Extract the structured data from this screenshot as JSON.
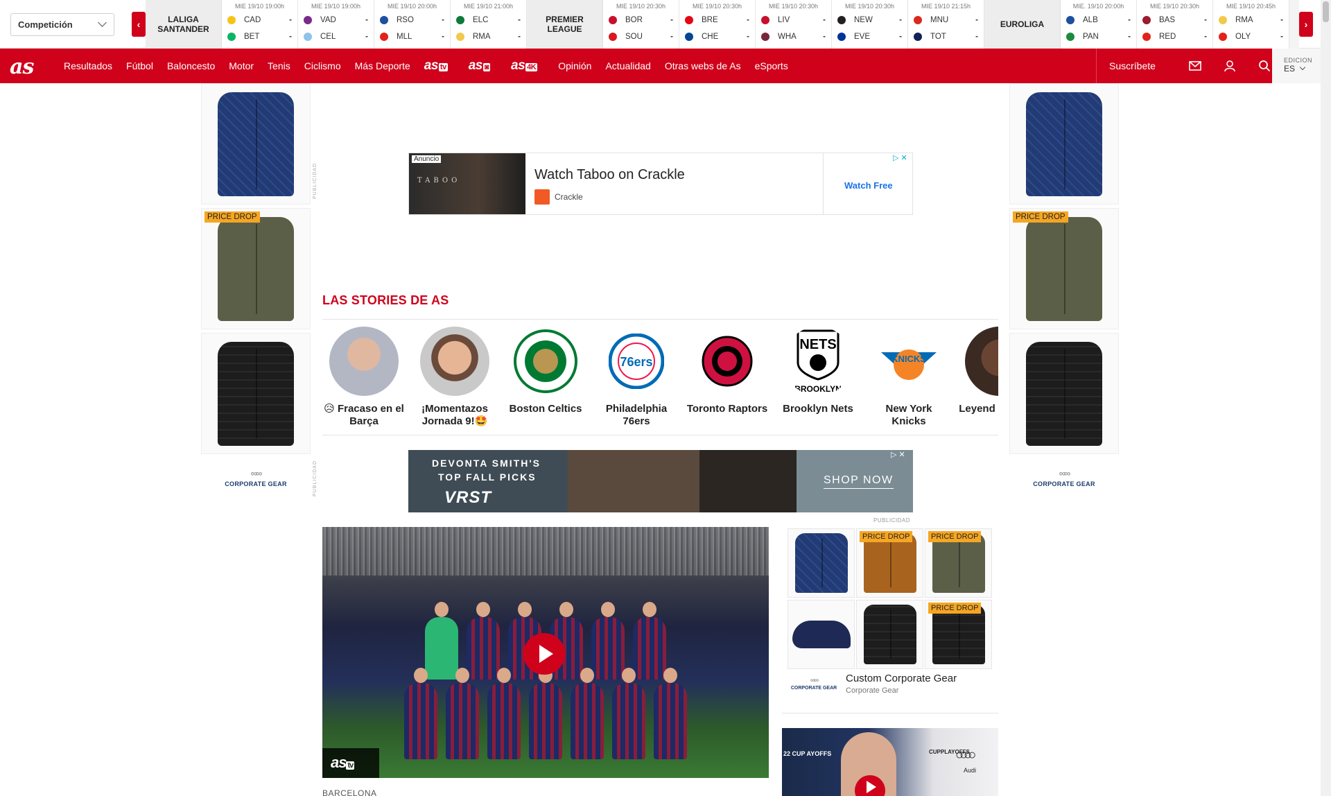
{
  "competition_select": {
    "label": "Competición"
  },
  "leagues": [
    {
      "name_l1": "LALIGA",
      "name_l2": "SANTANDER"
    },
    {
      "name_l1": "PREMIER",
      "name_l2": "LEAGUE"
    },
    {
      "name_l1": "EUROLIGA",
      "name_l2": ""
    }
  ],
  "matches": [
    {
      "date": "MIE 19/10 19:00h",
      "home": "CAD",
      "away": "BET",
      "home_score": "-",
      "away_score": "-",
      "home_color": "#f6c31a",
      "away_color": "#0bb363"
    },
    {
      "date": "MIE 19/10 19:00h",
      "home": "VAD",
      "away": "CEL",
      "home_score": "-",
      "away_score": "-",
      "home_color": "#7a2a8c",
      "away_color": "#8ec3ea"
    },
    {
      "date": "MIE 19/10 20:00h",
      "home": "RSO",
      "away": "MLL",
      "home_score": "-",
      "away_score": "-",
      "home_color": "#1f4fa0",
      "away_color": "#e2231a"
    },
    {
      "date": "MIE 19/10 21:00h",
      "home": "ELC",
      "away": "RMA",
      "home_score": "-",
      "away_score": "-",
      "home_color": "#0c7a3a",
      "away_color": "#f2c94c"
    },
    {
      "date": "MIE 19/10 20:30h",
      "home": "BOR",
      "away": "SOU",
      "home_score": "-",
      "away_score": "-",
      "home_color": "#c8102e",
      "away_color": "#d71920"
    },
    {
      "date": "MIE 19/10 20:30h",
      "home": "BRE",
      "away": "CHE",
      "home_score": "-",
      "away_score": "-",
      "home_color": "#e30613",
      "away_color": "#034694"
    },
    {
      "date": "MIE 19/10 20:30h",
      "home": "LIV",
      "away": "WHA",
      "home_score": "-",
      "away_score": "-",
      "home_color": "#c8102e",
      "away_color": "#7a263a"
    },
    {
      "date": "MIE 19/10 20:30h",
      "home": "NEW",
      "away": "EVE",
      "home_score": "-",
      "away_score": "-",
      "home_color": "#241f20",
      "away_color": "#003399"
    },
    {
      "date": "MIE 19/10 21:15h",
      "home": "MNU",
      "away": "TOT",
      "home_score": "-",
      "away_score": "-",
      "home_color": "#da291c",
      "away_color": "#132257"
    },
    {
      "date": "MIE. 19/10 20:00h",
      "home": "ALB",
      "away": "PAN",
      "home_score": "-",
      "away_score": "-",
      "home_color": "#1f4fa0",
      "away_color": "#1b8b3d"
    },
    {
      "date": "MIE 19/10 20:30h",
      "home": "BAS",
      "away": "RED",
      "home_score": "-",
      "away_score": "-",
      "home_color": "#9b1b30",
      "away_color": "#e2231a"
    },
    {
      "date": "MIE 19/10 20:45h",
      "home": "RMA",
      "away": "OLY",
      "home_score": "-",
      "away_score": "-",
      "home_color": "#f2c94c",
      "away_color": "#e2231a"
    }
  ],
  "nav": {
    "logo": "as",
    "items": [
      "Resultados",
      "Fútbol",
      "Baloncesto",
      "Motor",
      "Tenis",
      "Ciclismo",
      "Más Deporte"
    ],
    "brands": [
      {
        "name": "as",
        "tag": "tv"
      },
      {
        "name": "as",
        "tag": "◙"
      },
      {
        "name": "as",
        "tag": "4K"
      }
    ],
    "items_after": [
      "Opinión",
      "Actualidad",
      "Otras webs de As",
      "eSports"
    ],
    "subscribe": "Suscríbete",
    "edition_label": "EDICION",
    "edition_value": "ES"
  },
  "side_ads": {
    "price_drop": "PRICE DROP",
    "brand": "CORPORATE GEAR",
    "publicidad": "PUBLICIDAD"
  },
  "banner_ad": {
    "tag": "Anuncio",
    "image_text": "TABOO",
    "title": "Watch Taboo on Crackle",
    "brand": "Crackle",
    "cta": "Watch Free"
  },
  "stories": {
    "title": "LAS STORIES DE AS",
    "items": [
      {
        "label": "😥 Fracaso en el Barça",
        "color": "#b3b7c4"
      },
      {
        "label": "¡Momentazos Jornada 9!🤩",
        "color": "#c9c9c9"
      },
      {
        "label": "Boston Celtics",
        "color": "#007a33"
      },
      {
        "label": "Philadelphia 76ers",
        "color": "#006bb6"
      },
      {
        "label": "Toronto Raptors",
        "color": "#ce1141"
      },
      {
        "label": "Brooklyn Nets",
        "color": "#000000"
      },
      {
        "label": "New York Knicks",
        "color": "#f58426"
      },
      {
        "label": "Leyend mate a L",
        "color": "#5a3a2a"
      }
    ]
  },
  "mid_ad": {
    "line1": "DEVONTA SMITH'S",
    "line2": "TOP FALL PICKS",
    "brand": "VRST",
    "cta": "SHOP NOW",
    "publicidad": "PUBLICIDAD"
  },
  "main_video": {
    "badge_name": "as",
    "badge_tag": "tv",
    "kicker": "BARCELONA"
  },
  "grid_ad": {
    "price_drop": "PRICE DROP",
    "title": "Custom Corporate Gear",
    "brand": "Corporate Gear",
    "logo": "CORPORATE GEAR"
  },
  "side_video": {
    "text_left": "22 CUP AYOFFS",
    "text_right": "CUPPLAYOFFS",
    "sponsor": "Audi"
  }
}
